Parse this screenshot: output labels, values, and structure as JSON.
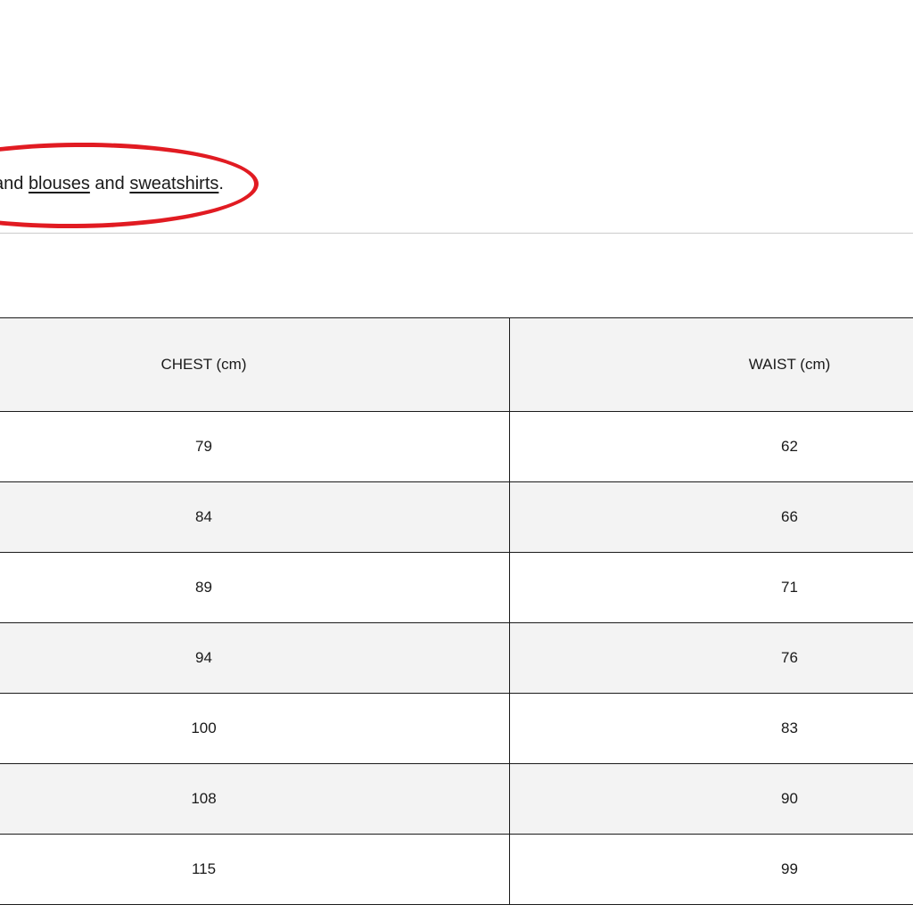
{
  "intro": {
    "prefix": "and ",
    "link_blouses": "blouses",
    "middle": " and ",
    "link_sweatshirts": "sweatshirts",
    "suffix": "."
  },
  "table": {
    "headers": [
      "CHEST (cm)",
      "WAIST (cm)"
    ],
    "rows": [
      [
        "79",
        "62"
      ],
      [
        "84",
        "66"
      ],
      [
        "89",
        "71"
      ],
      [
        "94",
        "76"
      ],
      [
        "100",
        "83"
      ],
      [
        "108",
        "90"
      ],
      [
        "115",
        "99"
      ]
    ]
  },
  "colors": {
    "highlight": "#e11b22",
    "stripe": "#f3f3f3",
    "border": "#1a1a1a"
  }
}
